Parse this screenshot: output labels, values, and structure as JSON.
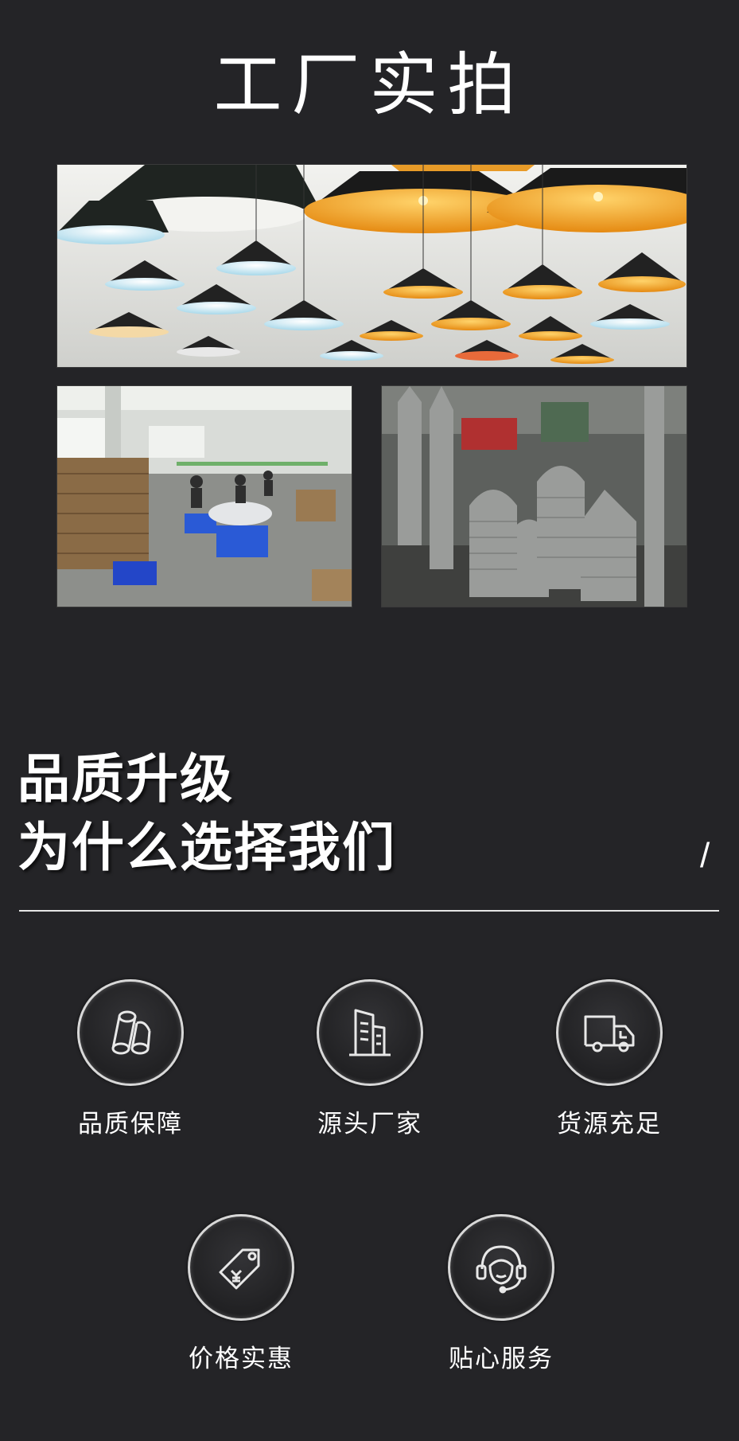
{
  "page_title": "工厂实拍",
  "photos": {
    "top": "pendant-lamps-showroom",
    "bottom_left": "packing-workshop",
    "bottom_right": "metal-shades-production"
  },
  "heading": {
    "line1": "品质升级",
    "line2": "为什么选择我们",
    "slash": "/"
  },
  "features": [
    {
      "label": "品质保障",
      "icon": "tubes-icon"
    },
    {
      "label": "源头厂家",
      "icon": "building-icon"
    },
    {
      "label": "货源充足",
      "icon": "truck-icon"
    },
    {
      "label": "价格实惠",
      "icon": "price-tag-icon"
    },
    {
      "label": "贴心服务",
      "icon": "headset-icon"
    }
  ],
  "colors": {
    "background": "#242427",
    "text": "#ffffff",
    "divider": "#e6e6e6",
    "lamp_orange": "#f0a020",
    "lamp_blue": "#bfe3f0"
  }
}
